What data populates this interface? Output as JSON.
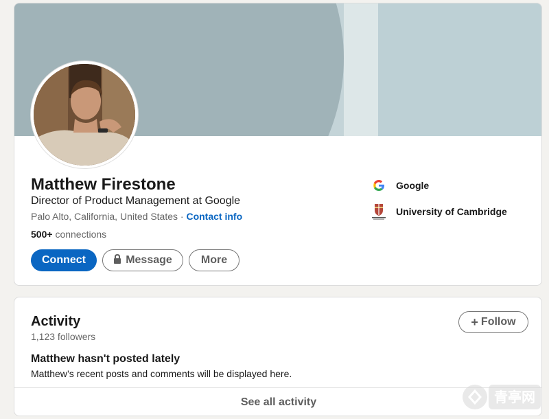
{
  "profile": {
    "name": "Matthew Firestone",
    "headline": "Director of Product Management at Google",
    "location": "Palo Alto, California, United States",
    "separator": "·",
    "contact_info": "Contact info",
    "connections_count": "500+",
    "connections_label": "connections",
    "buttons": {
      "connect": "Connect",
      "message": "Message",
      "more": "More"
    },
    "affiliations": [
      {
        "name": "Google",
        "icon": "google-logo-icon"
      },
      {
        "name": "University of Cambridge",
        "icon": "cambridge-crest-icon"
      }
    ],
    "colors": {
      "primary": "#0a66c2",
      "banner": "#a0b3b8"
    }
  },
  "activity": {
    "title": "Activity",
    "followers": "1,123 followers",
    "follow_button": "Follow",
    "empty_title": "Matthew hasn't posted lately",
    "empty_desc": "Matthew’s recent posts and comments will be displayed here.",
    "see_all": "See all activity"
  },
  "watermark": {
    "text": "青亭网"
  }
}
